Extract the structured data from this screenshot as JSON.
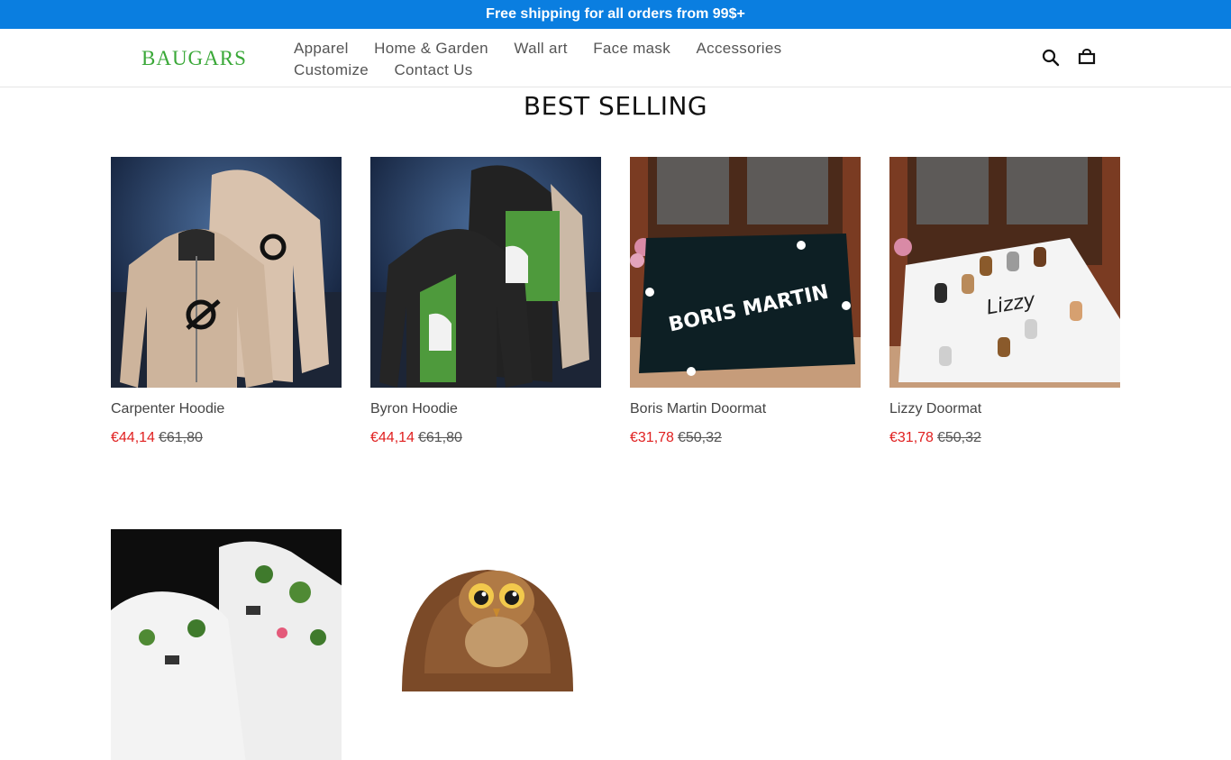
{
  "announcement": "Free shipping for all orders from 99$+",
  "logo": "BAUGARS",
  "nav": [
    "Apparel",
    "Home & Garden",
    "Wall art",
    "Face mask",
    "Accessories",
    "Customize",
    "Contact Us"
  ],
  "section_title": "BEST SELLING",
  "products": [
    {
      "name": "Carpenter Hoodie",
      "price": "€44,14",
      "original": "€61,80"
    },
    {
      "name": "Byron Hoodie",
      "price": "€44,14",
      "original": "€61,80"
    },
    {
      "name": "Boris Martin Doormat",
      "price": "€31,78",
      "original": "€50,32"
    },
    {
      "name": "Lizzy Doormat",
      "price": "€31,78",
      "original": "€50,32"
    }
  ],
  "mat_text": {
    "boris": "BORIS MARTIN",
    "lizzy": "Lizzy"
  },
  "colors": {
    "accent": "#0a7ee0",
    "logo": "#3aa838",
    "sale": "#e02020"
  }
}
